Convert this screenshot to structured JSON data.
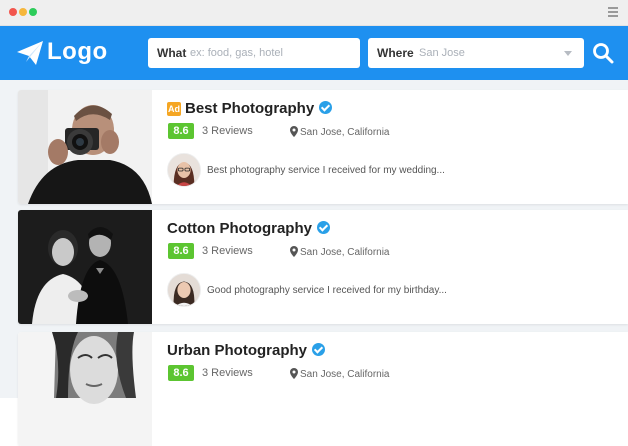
{
  "window": {
    "dot_colors": [
      "#f2564e",
      "#f6b73c",
      "#2dcc5a"
    ]
  },
  "header": {
    "brand": "Logo",
    "what_label": "What",
    "what_placeholder": "ex: food, gas, hotel",
    "where_label": "Where",
    "where_value": "San Jose",
    "accent": "#1e90f0"
  },
  "listings": [
    {
      "ad_badge": "Ad",
      "name": "Best Photography",
      "score": "8.6",
      "reviews": "3 Reviews",
      "location": "San Jose, California",
      "review_text": "Best photography service I received for my wedding..."
    },
    {
      "name": "Cotton Photography",
      "score": "8.6",
      "reviews": "3 Reviews",
      "location": "San Jose, California",
      "review_text": "Good photography service I received for my birthday..."
    },
    {
      "name": "Urban Photography",
      "score": "8.6",
      "reviews": "3 Reviews",
      "location": "San Jose, California",
      "review_text": ""
    }
  ]
}
